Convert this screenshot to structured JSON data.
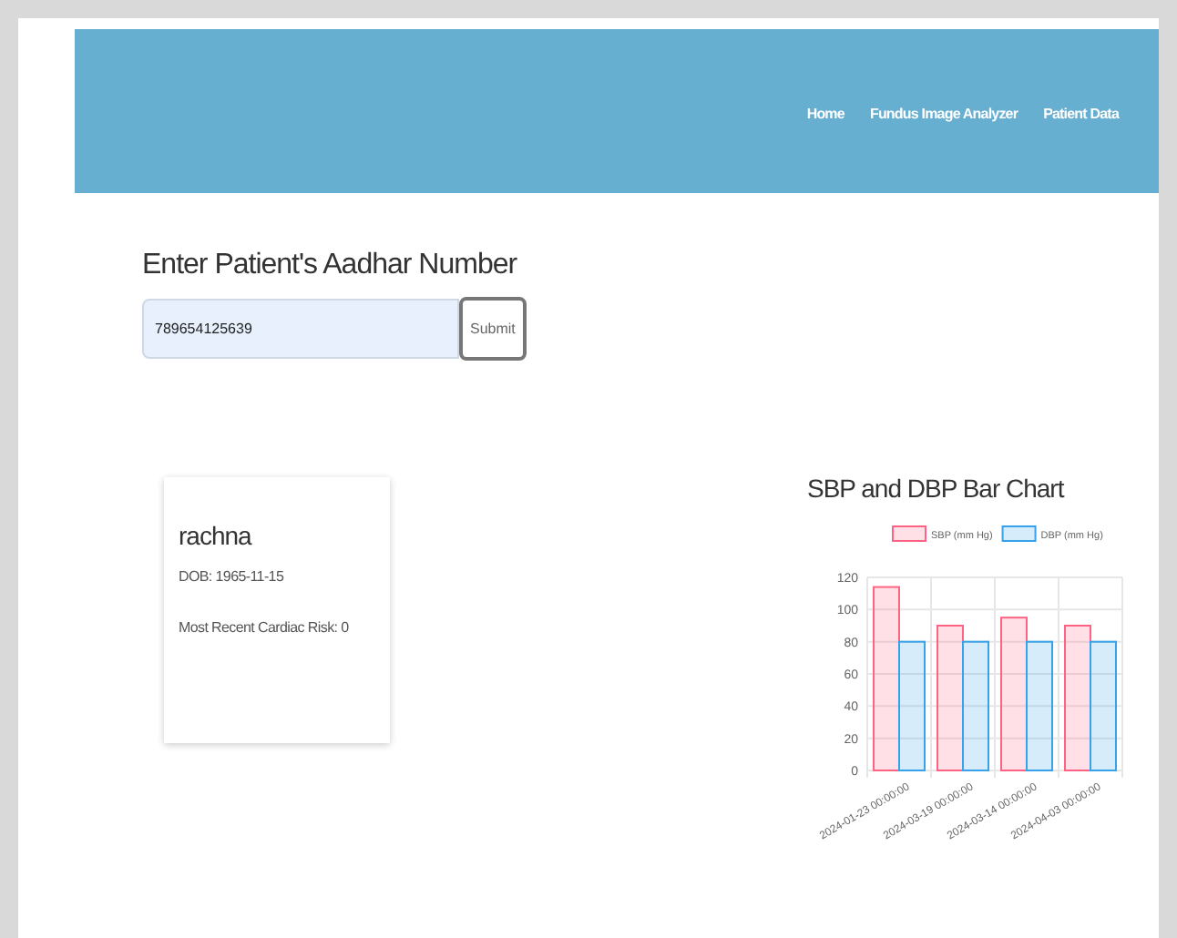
{
  "navbar": {
    "links": [
      {
        "label": "Home"
      },
      {
        "label": "Fundus Image Analyzer"
      },
      {
        "label": "Patient Data"
      }
    ]
  },
  "search": {
    "heading": "Enter Patient's Aadhar Number",
    "value": "789654125639",
    "button": "Submit"
  },
  "patient_card": {
    "name": "rachna",
    "dob": "DOB: 1965-11-15",
    "risk": "Most Recent Cardiac Risk: 0"
  },
  "chart": {
    "title": "SBP and DBP Bar Chart",
    "chart_data": {
      "type": "bar",
      "categories": [
        "2024-01-23 00:00:00",
        "2024-03-19 00:00:00",
        "2024-03-14 00:00:00",
        "2024-04-03 00:00:00"
      ],
      "series": [
        {
          "name": "SBP (mm Hg)",
          "color": "#ff6384",
          "values": [
            114,
            90,
            95,
            90
          ]
        },
        {
          "name": "DBP (mm Hg)",
          "color": "#36a2eb",
          "values": [
            80,
            80,
            80,
            80
          ]
        }
      ],
      "ylim": [
        0,
        120
      ],
      "yticks": [
        0,
        20,
        40,
        60,
        80,
        100,
        120
      ],
      "grid": true,
      "legend": true
    }
  }
}
